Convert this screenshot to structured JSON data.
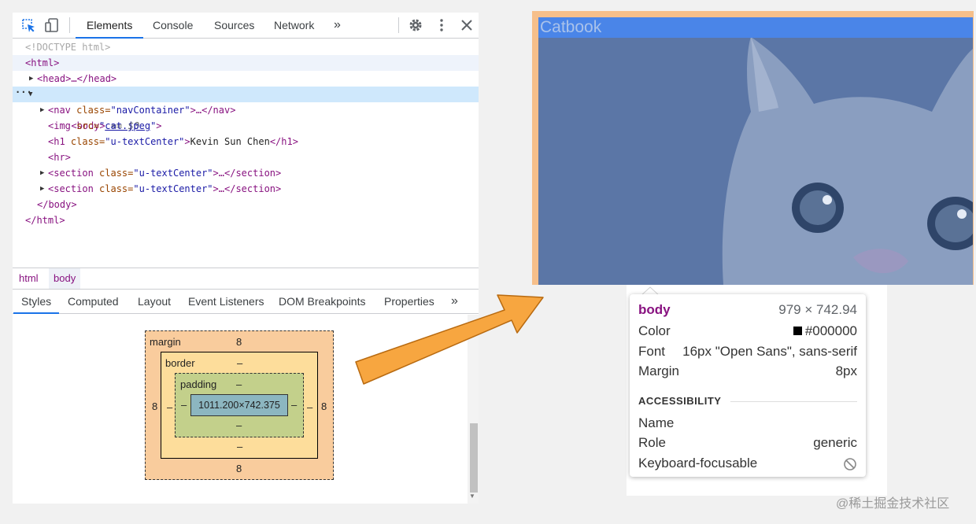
{
  "devtools": {
    "tabs": [
      "Elements",
      "Console",
      "Sources",
      "Network",
      "»"
    ],
    "dom_lines": {
      "doctype": "<!DOCTYPE html>",
      "html_open": "<html>",
      "head": "<head>…</head>",
      "body_open": "<body>",
      "body_ref": " == $0",
      "ellipsis": "···",
      "nav_open": "<nav ",
      "nav_attr": "class=",
      "nav_val": "\"navContainer\"",
      "nav_close": ">…</nav>",
      "img_open": "<img ",
      "img_attr": "src=",
      "img_q1": "\"",
      "img_link": "cat.jpeg",
      "img_q2": "\"",
      "img_close": ">",
      "h1_open": "<h1 ",
      "h1_attr": "class=",
      "h1_val": "\"u-textCenter\"",
      "h1_gt": ">",
      "h1_text": "Kevin Sun Chen",
      "h1_close": "</h1>",
      "hr": "<hr>",
      "section_open": "<section ",
      "section_attr": "class=",
      "section_val": "\"u-textCenter\"",
      "section_close": ">…</section>",
      "body_close": "</body>",
      "html_close": "</html>"
    },
    "breadcrumbs": [
      "html",
      "body"
    ],
    "style_tabs": [
      "Styles",
      "Computed",
      "Layout",
      "Event Listeners",
      "DOM Breakpoints",
      "Properties",
      "»"
    ],
    "box_model": {
      "margin_label": "margin",
      "margin_top": "8",
      "margin_bottom": "8",
      "margin_left": "8",
      "margin_right": "8",
      "border_label": "border",
      "border_top": "–",
      "border_bottom": "–",
      "border_left": "–",
      "border_right": "–",
      "padding_label": "padding",
      "padding_top": "–",
      "padding_bottom": "–",
      "padding_left": "–",
      "padding_right": "–",
      "content": "1011.200×742.375"
    }
  },
  "page": {
    "brand": "Catbook"
  },
  "tooltip": {
    "element": "body",
    "size": "979 × 742.94",
    "color_label": "Color",
    "color_value": "#000000",
    "color_swatch": "#000000",
    "font_label": "Font",
    "font_value": "16px \"Open Sans\", sans-serif",
    "margin_label": "Margin",
    "margin_value": "8px",
    "accessibility_heading": "ACCESSIBILITY",
    "name_label": "Name",
    "role_label": "Role",
    "role_value": "generic",
    "keyboard_label": "Keyboard-focusable"
  },
  "watermark": "@稀土掘金技术社区",
  "colors": {
    "accent": "#1a73e8",
    "tag": "#881280",
    "attr": "#994500",
    "value": "#1a1aa6",
    "arrow": "#f7a640",
    "highlight": "#5b76a6"
  },
  "icons": [
    "inspect-icon",
    "device-toggle-icon",
    "gear-icon",
    "more-vert-icon",
    "close-icon",
    "expand-triangle-icon",
    "not-allowed-icon",
    "arrow"
  ]
}
